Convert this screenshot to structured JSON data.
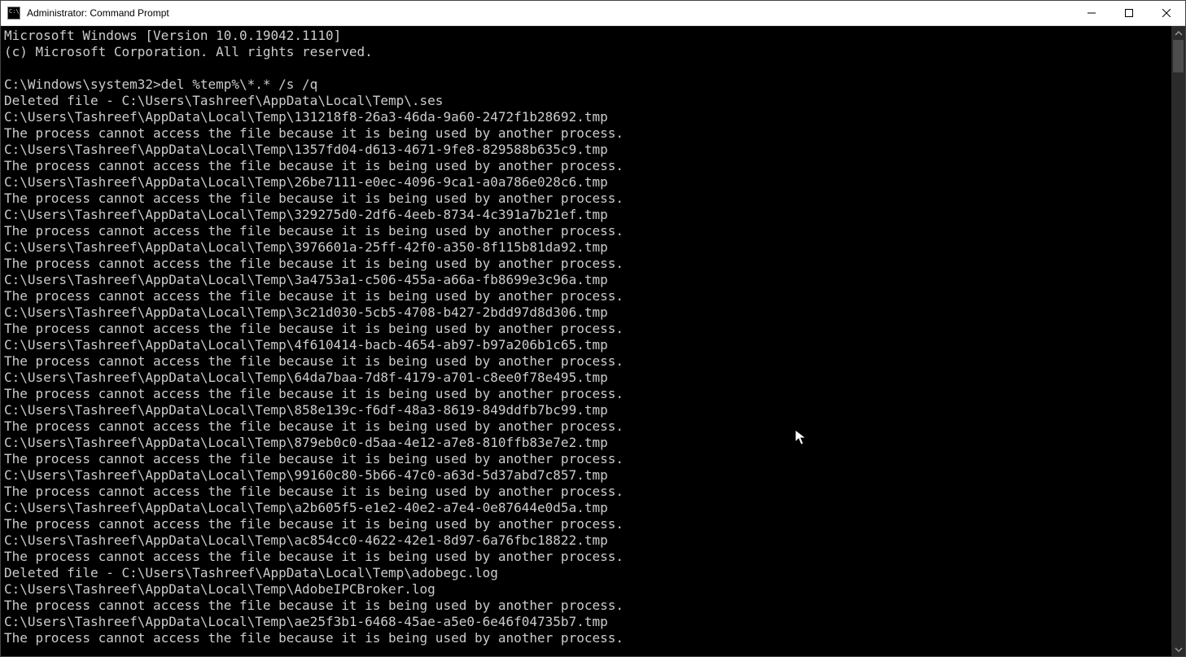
{
  "window": {
    "title": "Administrator: Command Prompt"
  },
  "terminal": {
    "lines": [
      "Microsoft Windows [Version 10.0.19042.1110]",
      "(c) Microsoft Corporation. All rights reserved.",
      "",
      "C:\\Windows\\system32>del %temp%\\*.* /s /q",
      "Deleted file - C:\\Users\\Tashreef\\AppData\\Local\\Temp\\.ses",
      "C:\\Users\\Tashreef\\AppData\\Local\\Temp\\131218f8-26a3-46da-9a60-2472f1b28692.tmp",
      "The process cannot access the file because it is being used by another process.",
      "C:\\Users\\Tashreef\\AppData\\Local\\Temp\\1357fd04-d613-4671-9fe8-829588b635c9.tmp",
      "The process cannot access the file because it is being used by another process.",
      "C:\\Users\\Tashreef\\AppData\\Local\\Temp\\26be7111-e0ec-4096-9ca1-a0a786e028c6.tmp",
      "The process cannot access the file because it is being used by another process.",
      "C:\\Users\\Tashreef\\AppData\\Local\\Temp\\329275d0-2df6-4eeb-8734-4c391a7b21ef.tmp",
      "The process cannot access the file because it is being used by another process.",
      "C:\\Users\\Tashreef\\AppData\\Local\\Temp\\3976601a-25ff-42f0-a350-8f115b81da92.tmp",
      "The process cannot access the file because it is being used by another process.",
      "C:\\Users\\Tashreef\\AppData\\Local\\Temp\\3a4753a1-c506-455a-a66a-fb8699e3c96a.tmp",
      "The process cannot access the file because it is being used by another process.",
      "C:\\Users\\Tashreef\\AppData\\Local\\Temp\\3c21d030-5cb5-4708-b427-2bdd97d8d306.tmp",
      "The process cannot access the file because it is being used by another process.",
      "C:\\Users\\Tashreef\\AppData\\Local\\Temp\\4f610414-bacb-4654-ab97-b97a206b1c65.tmp",
      "The process cannot access the file because it is being used by another process.",
      "C:\\Users\\Tashreef\\AppData\\Local\\Temp\\64da7baa-7d8f-4179-a701-c8ee0f78e495.tmp",
      "The process cannot access the file because it is being used by another process.",
      "C:\\Users\\Tashreef\\AppData\\Local\\Temp\\858e139c-f6df-48a3-8619-849ddfb7bc99.tmp",
      "The process cannot access the file because it is being used by another process.",
      "C:\\Users\\Tashreef\\AppData\\Local\\Temp\\879eb0c0-d5aa-4e12-a7e8-810ffb83e7e2.tmp",
      "The process cannot access the file because it is being used by another process.",
      "C:\\Users\\Tashreef\\AppData\\Local\\Temp\\99160c80-5b66-47c0-a63d-5d37abd7c857.tmp",
      "The process cannot access the file because it is being used by another process.",
      "C:\\Users\\Tashreef\\AppData\\Local\\Temp\\a2b605f5-e1e2-40e2-a7e4-0e87644e0d5a.tmp",
      "The process cannot access the file because it is being used by another process.",
      "C:\\Users\\Tashreef\\AppData\\Local\\Temp\\ac854cc0-4622-42e1-8d97-6a76fbc18822.tmp",
      "The process cannot access the file because it is being used by another process.",
      "Deleted file - C:\\Users\\Tashreef\\AppData\\Local\\Temp\\adobegc.log",
      "C:\\Users\\Tashreef\\AppData\\Local\\Temp\\AdobeIPCBroker.log",
      "The process cannot access the file because it is being used by another process.",
      "C:\\Users\\Tashreef\\AppData\\Local\\Temp\\ae25f3b1-6468-45ae-a5e0-6e46f04735b7.tmp",
      "The process cannot access the file because it is being used by another process."
    ]
  }
}
